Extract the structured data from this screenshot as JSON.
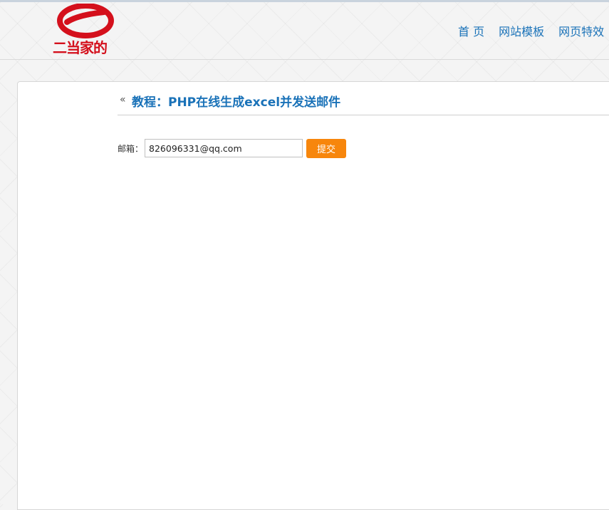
{
  "header": {
    "logo_text": "二当家的",
    "nav": [
      {
        "label": "首 页"
      },
      {
        "label": "网站模板"
      },
      {
        "label": "网页特效"
      }
    ]
  },
  "main": {
    "back_icon": "«",
    "title": "教程：PHP在线生成excel并发送邮件",
    "form": {
      "email_label": "邮箱：",
      "email_value": "826096331@qq.com",
      "submit_label": "提交"
    }
  },
  "colors": {
    "brand_red": "#d4101c",
    "link_blue": "#1a72b8",
    "button_orange": "#f7860c"
  }
}
